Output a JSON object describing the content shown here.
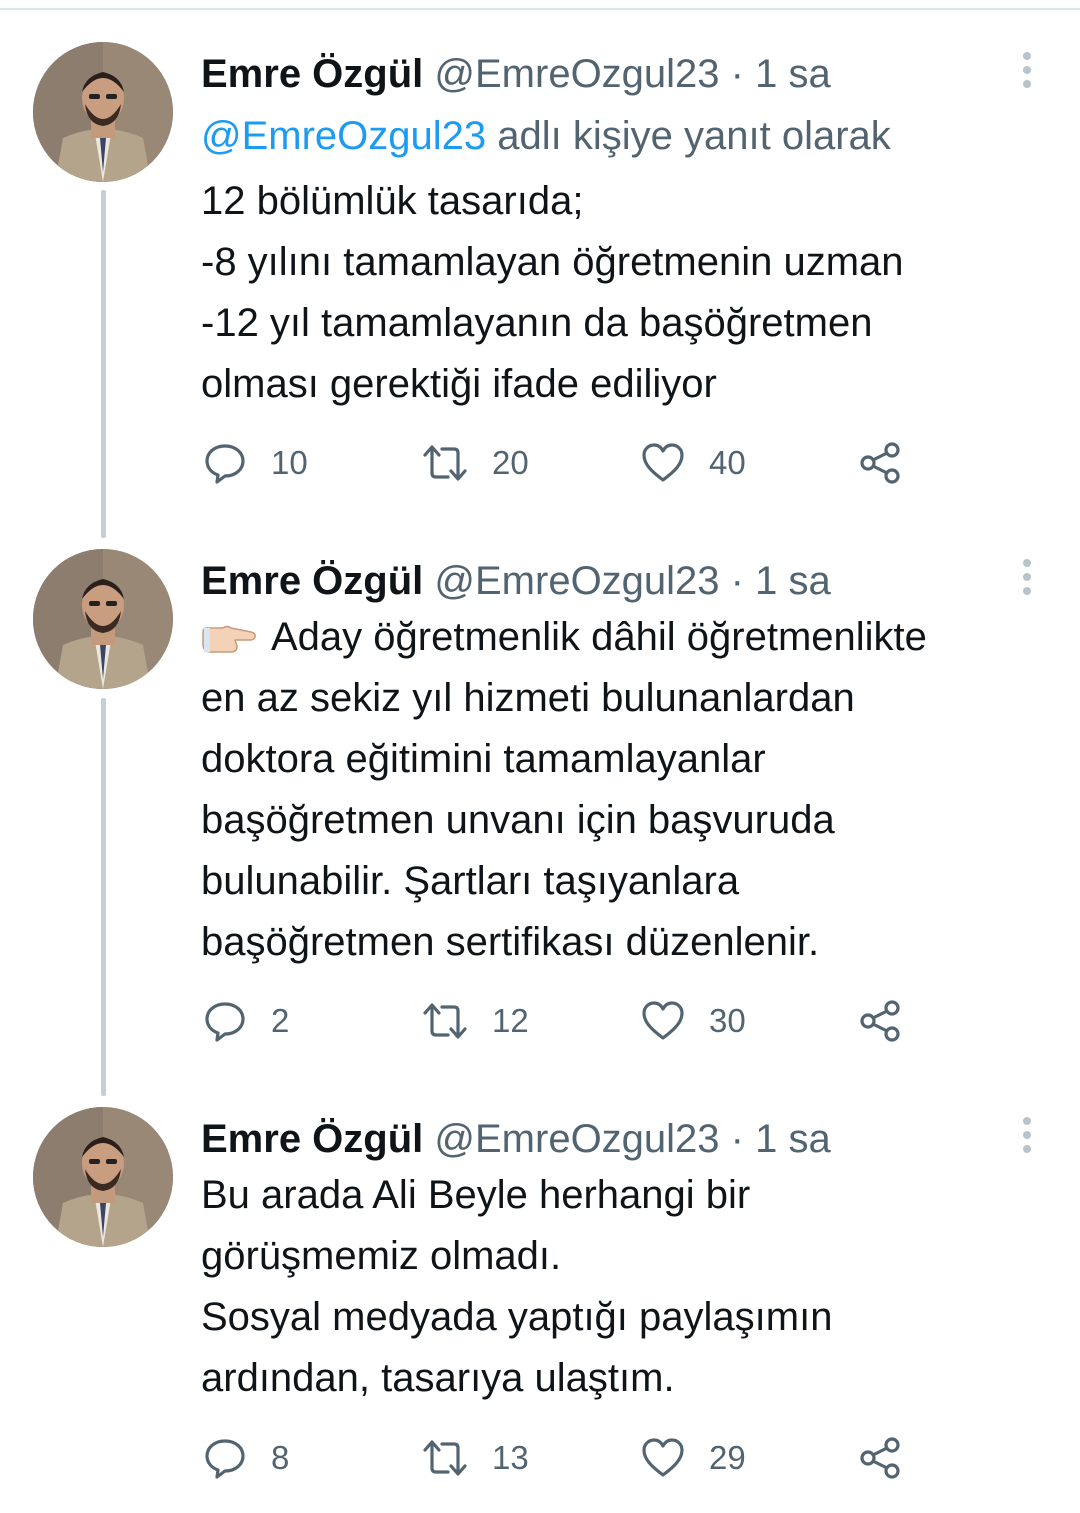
{
  "tweets": [
    {
      "name": "Emre Özgül",
      "handle": "@EmreOzgul23",
      "dot": "·",
      "time": "1 sa",
      "reply": {
        "mention": "@EmreOzgul23",
        "suffix": " adlı kişiye yanıt olarak"
      },
      "lines": [
        "12 bölümlük tasarıda;",
        "-8 yılını tamamlayan öğretmenin uzman",
        "-12 yıl tamamlayanın da başöğretmen",
        "olması gerektiği ifade ediliyor"
      ],
      "replies": "10",
      "retweets": "20",
      "likes": "40"
    },
    {
      "name": "Emre Özgül",
      "handle": "@EmreOzgul23",
      "dot": "·",
      "time": "1 sa",
      "emoji": "pointing-right-emoji",
      "lines": [
        "Aday öğretmenlik dâhil öğretmenlikte",
        "en az sekiz yıl hizmeti bulunanlardan",
        "doktora eğitimini tamamlayanlar",
        "başöğretmen unvanı için başvuruda",
        "bulunabilir. Şartları taşıyanlara",
        "başöğretmen sertifikası düzenlenir."
      ],
      "replies": "2",
      "retweets": "12",
      "likes": "30"
    },
    {
      "name": "Emre Özgül",
      "handle": "@EmreOzgul23",
      "dot": "·",
      "time": "1 sa",
      "lines": [
        "Bu arada Ali Beyle herhangi bir",
        "görüşmemiz olmadı.",
        "Sosyal medyada yaptığı paylaşımın",
        "ardından, tasarıya ulaştım."
      ],
      "replies": "8",
      "retweets": "13",
      "likes": "29"
    }
  ],
  "icons": {
    "reply": "comment-icon",
    "retweet": "retweet-icon",
    "like": "heart-icon",
    "share": "share-icon",
    "more": "more-vertical-icon"
  },
  "colors": {
    "text": "#0f1419",
    "secondary": "#536471",
    "accent": "#1d9bf0",
    "thread_line": "#c4cfd6"
  }
}
